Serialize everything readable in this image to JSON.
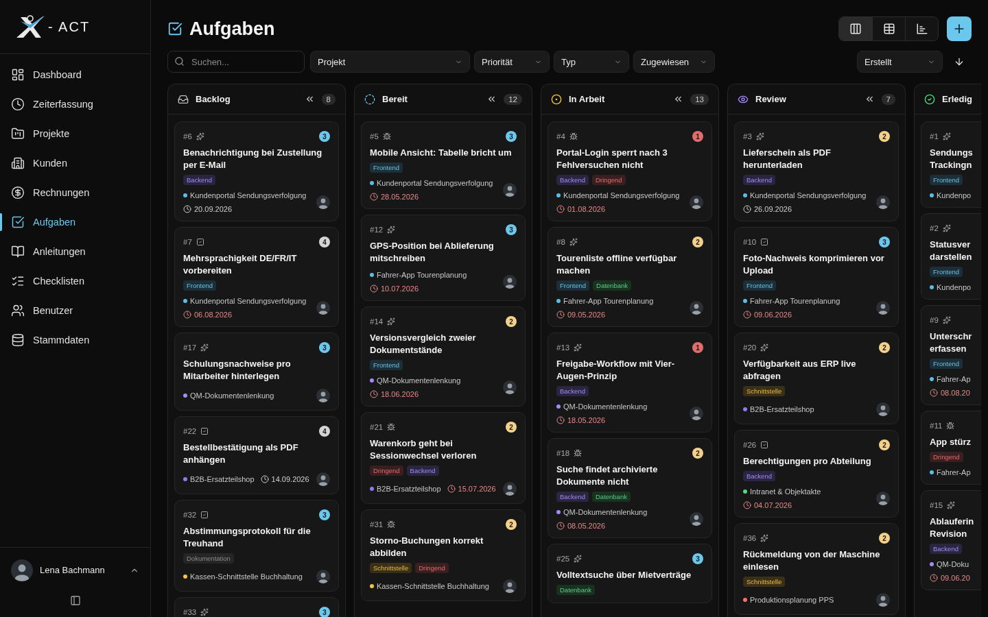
{
  "sidebar": {
    "brand": "- ACT",
    "items": [
      {
        "label": "Dashboard",
        "selected": false
      },
      {
        "label": "Zeiterfassung",
        "selected": false
      },
      {
        "label": "Projekte",
        "selected": false
      },
      {
        "label": "Kunden",
        "selected": false
      },
      {
        "label": "Rechnungen",
        "selected": false
      },
      {
        "label": "Aufgaben",
        "selected": true
      },
      {
        "label": "Anleitungen",
        "selected": false
      },
      {
        "label": "Checklisten",
        "selected": false
      },
      {
        "label": "Benutzer",
        "selected": false
      },
      {
        "label": "Stammdaten",
        "selected": false
      }
    ],
    "user": {
      "name": "Lena Bachmann"
    }
  },
  "header": {
    "title": "Aufgaben",
    "views": [
      {
        "selected": true
      },
      {
        "selected": false
      },
      {
        "selected": false
      }
    ]
  },
  "filters": {
    "search": {
      "placeholder": "Suchen..."
    },
    "selects": [
      "Projekt",
      "Priorität",
      "Typ",
      "Zugewiesen"
    ],
    "sort": "Erstellt"
  },
  "columns": [
    {
      "title": "Backlog",
      "kind": "backlog",
      "count": "8",
      "cards": [
        {
          "number": "#6",
          "kind": "feature",
          "priority": {
            "label": "3",
            "color": "#6cc7ec"
          },
          "title": "Benachrichtigung bei Zustellung per E-Mail",
          "tags": [
            {
              "label": "Backend",
              "kind": "backend"
            }
          ],
          "project": {
            "name": "Kundenportal Sendungsverfolgung",
            "color": "#5bbde6"
          },
          "avatar": true,
          "due": {
            "date": "20.09.2026",
            "overdue": false
          },
          "meta_inline": false
        },
        {
          "number": "#7",
          "kind": "task",
          "priority": {
            "label": "4",
            "color": "#d4d4d4"
          },
          "title": "Mehrsprachigkeit DE/FR/IT vorbereiten",
          "tags": [
            {
              "label": "Frontend",
              "kind": "frontend"
            }
          ],
          "project": {
            "name": "Kundenportal Sendungsverfolgung",
            "color": "#5bbde6"
          },
          "avatar": true,
          "due": {
            "date": "06.08.2026",
            "overdue": true
          },
          "meta_inline": false
        },
        {
          "number": "#17",
          "kind": "feature",
          "priority": {
            "label": "3",
            "color": "#6cc7ec"
          },
          "title": "Schulungsnachweise pro Mitarbeiter hinterlegen",
          "project": {
            "name": "QM-Dokumentenlenkung",
            "color": "#a78bfa"
          },
          "avatar": true,
          "meta_inline": false
        },
        {
          "number": "#22",
          "kind": "task",
          "priority": {
            "label": "4",
            "color": "#d4d4d4"
          },
          "title": "Bestellbestätigung als PDF anhängen",
          "project": {
            "name": "B2B-Ersatzteilshop",
            "color": "#8b7cf6"
          },
          "avatar": true,
          "due": {
            "date": "14.09.2026",
            "overdue": false
          },
          "meta_inline": true
        },
        {
          "number": "#32",
          "kind": "task",
          "priority": {
            "label": "3",
            "color": "#6cc7ec"
          },
          "title": "Abstimmungsprotokoll für die Treuhand",
          "tags": [
            {
              "label": "Dokumentation",
              "kind": "docs"
            }
          ],
          "project": {
            "name": "Kassen-Schnittstelle Buchhaltung",
            "color": "#f5c542"
          },
          "avatar": true,
          "meta_inline": false
        },
        {
          "number": "#33",
          "kind": "feature",
          "priority": {
            "label": "3",
            "color": "#6cc7ec"
          }
        }
      ]
    },
    {
      "title": "Bereit",
      "kind": "ready",
      "count": "12",
      "cards": [
        {
          "number": "#5",
          "kind": "bug",
          "priority": {
            "label": "3",
            "color": "#6cc7ec"
          },
          "title": "Mobile Ansicht: Tabelle bricht um",
          "tags": [
            {
              "label": "Frontend",
              "kind": "frontend"
            }
          ],
          "project": {
            "name": "Kundenportal Sendungsverfolgung",
            "color": "#5bbde6"
          },
          "avatar": true,
          "due": {
            "date": "28.05.2026",
            "overdue": true
          },
          "meta_inline": false
        },
        {
          "number": "#12",
          "kind": "feature",
          "priority": {
            "label": "3",
            "color": "#6cc7ec"
          },
          "title": "GPS-Position bei Ablieferung mitschreiben",
          "project": {
            "name": "Fahrer-App Tourenplanung",
            "color": "#5bbde6"
          },
          "avatar": true,
          "due": {
            "date": "10.07.2026",
            "overdue": true
          },
          "meta_inline": false
        },
        {
          "number": "#14",
          "kind": "feature",
          "priority": {
            "label": "2",
            "color": "#f5d08a"
          },
          "title": "Versionsvergleich zweier Dokumentstände",
          "tags": [
            {
              "label": "Frontend",
              "kind": "frontend"
            }
          ],
          "project": {
            "name": "QM-Dokumentenlenkung",
            "color": "#a78bfa"
          },
          "avatar": true,
          "due": {
            "date": "18.06.2026",
            "overdue": true
          },
          "meta_inline": false
        },
        {
          "number": "#21",
          "kind": "bug",
          "priority": {
            "label": "2",
            "color": "#f5d08a"
          },
          "title": "Warenkorb geht bei Sessionwechsel verloren",
          "tags": [
            {
              "label": "Dringend",
              "kind": "urgent"
            },
            {
              "label": "Backend",
              "kind": "backend"
            }
          ],
          "project": {
            "name": "B2B-Ersatzteilshop",
            "color": "#8b7cf6"
          },
          "avatar": true,
          "due": {
            "date": "15.07.2026",
            "overdue": true
          },
          "meta_inline": true
        },
        {
          "number": "#31",
          "kind": "bug",
          "priority": {
            "label": "2",
            "color": "#f5d08a"
          },
          "title": "Storno-Buchungen korrekt abbilden",
          "tags": [
            {
              "label": "Schnittstelle",
              "kind": "interface"
            },
            {
              "label": "Dringend",
              "kind": "urgent"
            }
          ],
          "project": {
            "name": "Kassen-Schnittstelle Buchhaltung",
            "color": "#f5c542"
          },
          "avatar": true,
          "meta_inline": false
        }
      ]
    },
    {
      "title": "In Arbeit",
      "kind": "progress",
      "count": "13",
      "cards": [
        {
          "number": "#4",
          "kind": "bug",
          "priority": {
            "label": "1",
            "color": "#e06c6c"
          },
          "title": "Portal-Login sperrt nach 3 Fehlversuchen nicht",
          "tags": [
            {
              "label": "Backend",
              "kind": "backend"
            },
            {
              "label": "Dringend",
              "kind": "urgent"
            }
          ],
          "project": {
            "name": "Kundenportal Sendungsverfolgung",
            "color": "#5bbde6"
          },
          "avatar": true,
          "due": {
            "date": "01.08.2026",
            "overdue": true
          },
          "meta_inline": false
        },
        {
          "number": "#8",
          "kind": "feature",
          "priority": {
            "label": "2",
            "color": "#f5d08a"
          },
          "title": "Tourenliste offline verfügbar machen",
          "tags": [
            {
              "label": "Frontend",
              "kind": "frontend"
            },
            {
              "label": "Datenbank",
              "kind": "database"
            }
          ],
          "project": {
            "name": "Fahrer-App Tourenplanung",
            "color": "#5bbde6"
          },
          "avatar": true,
          "due": {
            "date": "09.05.2026",
            "overdue": true
          },
          "meta_inline": false
        },
        {
          "number": "#13",
          "kind": "feature",
          "priority": {
            "label": "1",
            "color": "#e06c6c"
          },
          "title": "Freigabe-Workflow mit Vier-Augen-Prinzip",
          "tags": [
            {
              "label": "Backend",
              "kind": "backend"
            }
          ],
          "project": {
            "name": "QM-Dokumentenlenkung",
            "color": "#a78bfa"
          },
          "avatar": true,
          "due": {
            "date": "18.05.2026",
            "overdue": true
          },
          "meta_inline": false
        },
        {
          "number": "#18",
          "kind": "bug",
          "priority": {
            "label": "2",
            "color": "#f5d08a"
          },
          "title": "Suche findet archivierte Dokumente nicht",
          "tags": [
            {
              "label": "Backend",
              "kind": "backend"
            },
            {
              "label": "Datenbank",
              "kind": "database"
            }
          ],
          "project": {
            "name": "QM-Dokumentenlenkung",
            "color": "#a78bfa"
          },
          "avatar": true,
          "due": {
            "date": "08.05.2026",
            "overdue": true
          },
          "meta_inline": false
        },
        {
          "number": "#25",
          "kind": "feature",
          "priority": {
            "label": "3",
            "color": "#6cc7ec"
          },
          "title": "Volltextsuche über Mietverträge",
          "tags": [
            {
              "label": "Datenbank",
              "kind": "database"
            }
          ]
        }
      ]
    },
    {
      "title": "Review",
      "kind": "review",
      "count": "7",
      "cards": [
        {
          "number": "#3",
          "kind": "feature",
          "priority": {
            "label": "2",
            "color": "#f5d08a"
          },
          "title": "Lieferschein als PDF herunterladen",
          "tags": [
            {
              "label": "Backend",
              "kind": "backend"
            }
          ],
          "project": {
            "name": "Kundenportal Sendungsverfolgung",
            "color": "#5bbde6"
          },
          "avatar": true,
          "due": {
            "date": "26.09.2026",
            "overdue": false
          },
          "meta_inline": false
        },
        {
          "number": "#10",
          "kind": "task",
          "priority": {
            "label": "3",
            "color": "#6cc7ec"
          },
          "title": "Foto-Nachweis komprimieren vor Upload",
          "tags": [
            {
              "label": "Frontend",
              "kind": "frontend"
            }
          ],
          "project": {
            "name": "Fahrer-App Tourenplanung",
            "color": "#5bbde6"
          },
          "avatar": true,
          "due": {
            "date": "09.06.2026",
            "overdue": true
          },
          "meta_inline": false
        },
        {
          "number": "#20",
          "kind": "feature",
          "priority": {
            "label": "2",
            "color": "#f5d08a"
          },
          "title": "Verfügbarkeit aus ERP live abfragen",
          "tags": [
            {
              "label": "Schnittstelle",
              "kind": "interface"
            }
          ],
          "project": {
            "name": "B2B-Ersatzteilshop",
            "color": "#8b7cf6"
          },
          "avatar": true,
          "meta_inline": false
        },
        {
          "number": "#26",
          "kind": "task",
          "priority": {
            "label": "2",
            "color": "#f5d08a"
          },
          "title": "Berechtigungen pro Abteilung",
          "tags": [
            {
              "label": "Backend",
              "kind": "backend"
            }
          ],
          "project": {
            "name": "Intranet & Objektakte",
            "color": "#4ade80"
          },
          "avatar": true,
          "due": {
            "date": "04.07.2026",
            "overdue": true
          },
          "meta_inline": false
        },
        {
          "number": "#36",
          "kind": "feature",
          "priority": {
            "label": "2",
            "color": "#f5d08a"
          },
          "title": "Rückmeldung von der Maschine einlesen",
          "tags": [
            {
              "label": "Schnittstelle",
              "kind": "interface"
            }
          ],
          "project": {
            "name": "Produktionsplanung PPS",
            "color": "#f87171"
          },
          "avatar": true,
          "meta_inline": false
        }
      ]
    },
    {
      "title": "Erledig",
      "kind": "done",
      "cards": [
        {
          "number": "#1",
          "kind": "feature",
          "title": "Sendungs\nTrackingn",
          "tags": [
            {
              "label": "Frontend",
              "kind": "frontend"
            }
          ],
          "project": {
            "name": "Kundenpo",
            "color": "#5bbde6"
          },
          "meta_inline": false
        },
        {
          "number": "#2",
          "kind": "feature",
          "title": "Statusver\ndarstellen",
          "tags": [
            {
              "label": "Frontend",
              "kind": "frontend"
            }
          ],
          "project": {
            "name": "Kundenpo",
            "color": "#5bbde6"
          },
          "meta_inline": false
        },
        {
          "number": "#9",
          "kind": "feature",
          "title": "Unterschr\nerfassen",
          "tags": [
            {
              "label": "Frontend",
              "kind": "frontend"
            }
          ],
          "project": {
            "name": "Fahrer-Ap",
            "color": "#5bbde6"
          },
          "due": {
            "date": "08.08.20",
            "overdue": true
          },
          "meta_inline": false
        },
        {
          "number": "#11",
          "kind": "bug",
          "title": "App stürz",
          "tags": [
            {
              "label": "Dringend",
              "kind": "urgent"
            }
          ],
          "project": {
            "name": "Fahrer-Ap",
            "color": "#5bbde6"
          },
          "meta_inline": false
        },
        {
          "number": "#15",
          "kind": "feature",
          "title": "Ablauferin\nRevision",
          "tags": [
            {
              "label": "Backend",
              "kind": "backend"
            }
          ],
          "project": {
            "name": "QM-Doku",
            "color": "#a78bfa"
          },
          "due": {
            "date": "09.06.20",
            "overdue": true
          },
          "meta_inline": false
        }
      ]
    }
  ]
}
